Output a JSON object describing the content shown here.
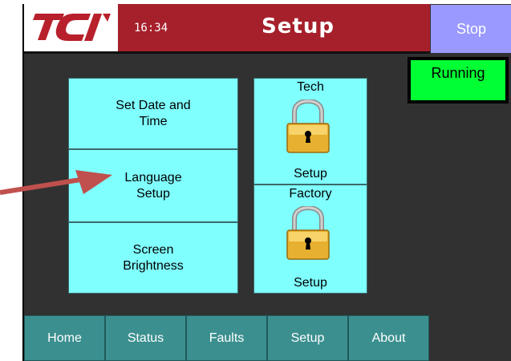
{
  "header": {
    "logo_text": "TCI",
    "clock": "16:34",
    "title": "Setup",
    "stop_label": "Stop"
  },
  "status": {
    "running_label": "Running",
    "running_color": "#00ff33"
  },
  "menu": {
    "set_date_time": "Set Date and Time",
    "language_setup": "Language Setup",
    "screen_brightness": "Screen Brightness",
    "tech_title": "Tech",
    "tech_action": "Setup",
    "factory_title": "Factory",
    "factory_action": "Setup"
  },
  "tabs": [
    {
      "label": "Home"
    },
    {
      "label": "Status"
    },
    {
      "label": "Faults"
    },
    {
      "label": "Setup"
    },
    {
      "label": "About"
    }
  ],
  "colors": {
    "title_bar": "#a6202b",
    "tile": "#80ffff",
    "tab": "#3b8f8f",
    "stop": "#9999ff",
    "arrow": "#c0504d"
  }
}
